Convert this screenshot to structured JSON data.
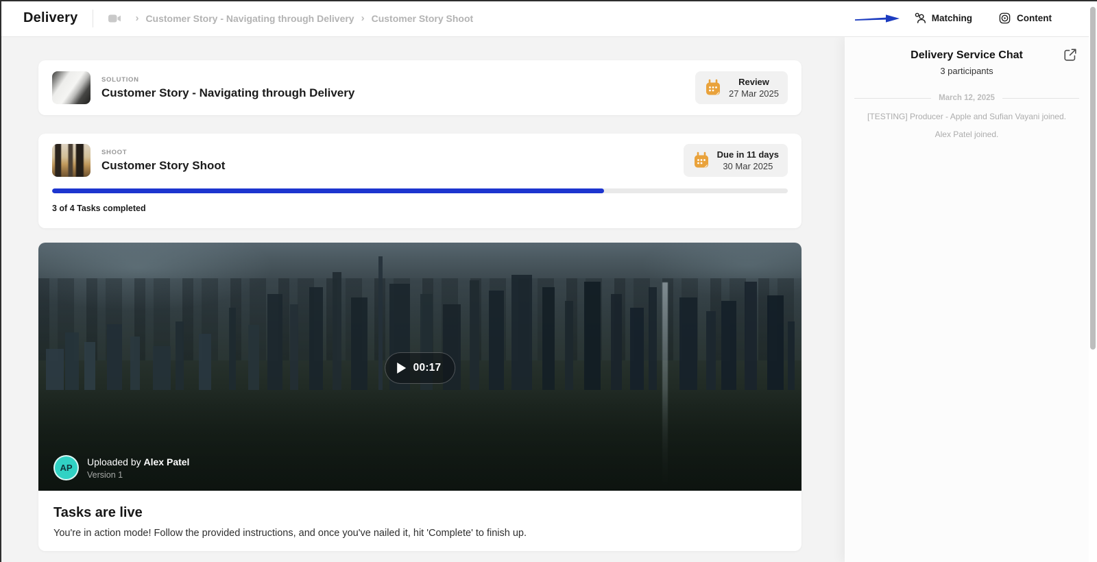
{
  "header": {
    "app_title": "Delivery",
    "breadcrumbs": [
      "Customer Story - Navigating through Delivery",
      "Customer Story Shoot"
    ],
    "matching_label": "Matching",
    "content_label": "Content"
  },
  "cards": {
    "solution": {
      "tag": "SOLUTION",
      "title": "Customer Story - Navigating through Delivery",
      "badge_title": "Review",
      "badge_date": "27 Mar 2025"
    },
    "shoot": {
      "tag": "SHOOT",
      "title": "Customer Story Shoot",
      "badge_title": "Due in 11 days",
      "badge_date": "30 Mar 2025",
      "progress_percent": 75,
      "progress_label": "3 of 4 Tasks completed"
    }
  },
  "video": {
    "duration": "00:17",
    "uploaded_by_prefix": "Uploaded by ",
    "uploader_name": "Alex Patel",
    "version": "Version 1",
    "avatar_initials": "AP"
  },
  "tasks": {
    "heading": "Tasks are live",
    "description": "You're in action mode! Follow the provided instructions, and once you've nailed it, hit 'Complete' to finish up."
  },
  "chat": {
    "title": "Delivery Service Chat",
    "participants": "3 participants",
    "date_divider": "March 12, 2025",
    "messages": [
      "[TESTING] Producer - Apple and Sufian Vayani joined.",
      "Alex Patel joined."
    ]
  },
  "colors": {
    "accent_blue": "#1c3cc0",
    "progress_blue": "#1d35cf",
    "calendar_orange": "#e9a23b",
    "avatar_teal": "#31d2c4"
  }
}
